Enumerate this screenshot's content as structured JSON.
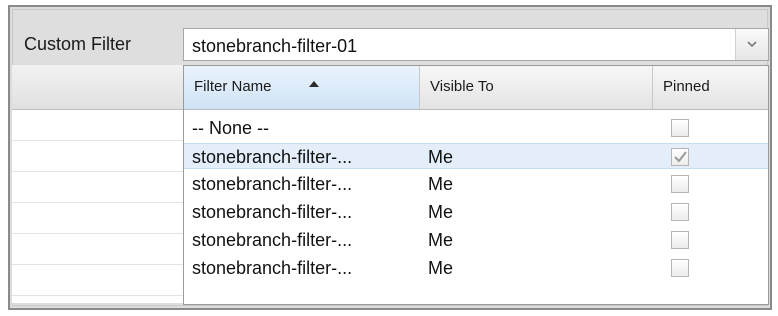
{
  "filter": {
    "label": "Custom Filter",
    "value": "stonebranch-filter-01",
    "dropdown_icon": "chevron-down-icon"
  },
  "dropdown": {
    "columns": [
      {
        "label": "Filter Name",
        "sort": "ascending",
        "sort_icon": "sort-ascending-icon"
      },
      {
        "label": "Visible To"
      },
      {
        "label": "Pinned"
      }
    ],
    "rows": [
      {
        "name": "-- None --",
        "visible_to": "",
        "pinned": false,
        "selected": false
      },
      {
        "name": "stonebranch-filter-...",
        "visible_to": "Me",
        "pinned": true,
        "selected": true
      },
      {
        "name": "stonebranch-filter-...",
        "visible_to": "Me",
        "pinned": false,
        "selected": false
      },
      {
        "name": "stonebranch-filter-...",
        "visible_to": "Me",
        "pinned": false,
        "selected": false
      },
      {
        "name": "stonebranch-filter-...",
        "visible_to": "Me",
        "pinned": false,
        "selected": false
      },
      {
        "name": "stonebranch-filter-...",
        "visible_to": "Me",
        "pinned": false,
        "selected": false
      }
    ]
  }
}
